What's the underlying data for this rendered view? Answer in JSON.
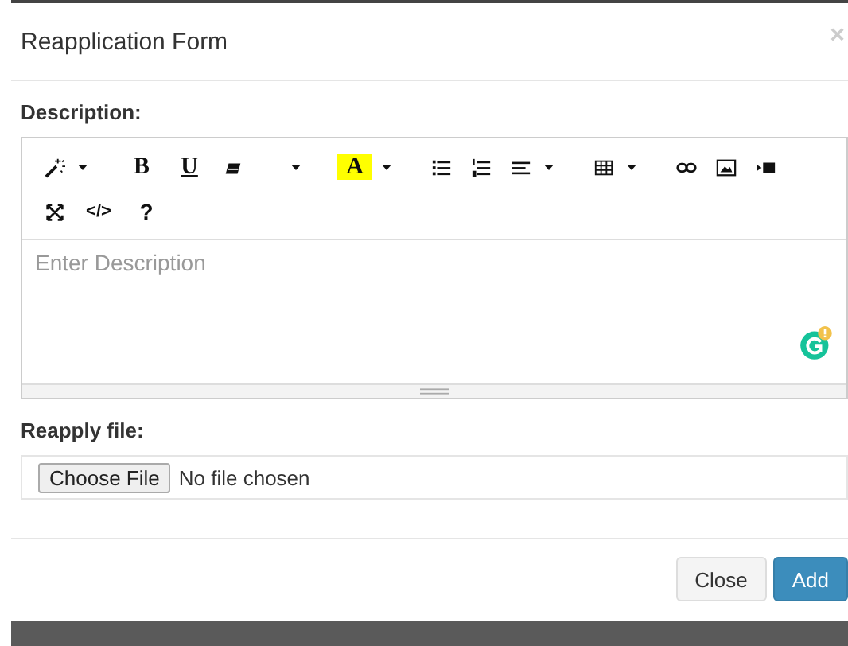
{
  "modal": {
    "title": "Reapplication Form",
    "close": "×"
  },
  "description": {
    "label": "Description:",
    "placeholder": "Enter Description",
    "toolbar": [
      [
        [
          {
            "kind": "magic",
            "dropdown": true
          }
        ],
        [
          {
            "kind": "bold",
            "label": "B",
            "dropdown": false
          },
          {
            "kind": "underline",
            "label": "U",
            "dropdown": false
          },
          {
            "kind": "eraser",
            "dropdown": false
          },
          {
            "kind": "caret",
            "dropdown": true
          }
        ],
        [
          {
            "kind": "color",
            "label": "A",
            "dropdown": true
          }
        ],
        [
          {
            "kind": "ul",
            "dropdown": false
          },
          {
            "kind": "ol",
            "dropdown": false
          },
          {
            "kind": "align",
            "dropdown": true
          }
        ],
        [
          {
            "kind": "table",
            "dropdown": true
          }
        ],
        [
          {
            "kind": "link",
            "dropdown": false
          },
          {
            "kind": "image",
            "dropdown": false
          },
          {
            "kind": "video",
            "dropdown": false
          }
        ]
      ],
      [
        [
          {
            "kind": "fullscreen",
            "dropdown": false
          },
          {
            "kind": "code",
            "label": "</>",
            "dropdown": false
          },
          {
            "kind": "help",
            "label": "?",
            "dropdown": false
          }
        ]
      ]
    ]
  },
  "file": {
    "label": "Reapply file:",
    "button": "Choose File",
    "status": "No file chosen"
  },
  "buttons": [
    {
      "kind": "default",
      "label": "Close"
    },
    {
      "kind": "primary",
      "label": "Add"
    }
  ]
}
